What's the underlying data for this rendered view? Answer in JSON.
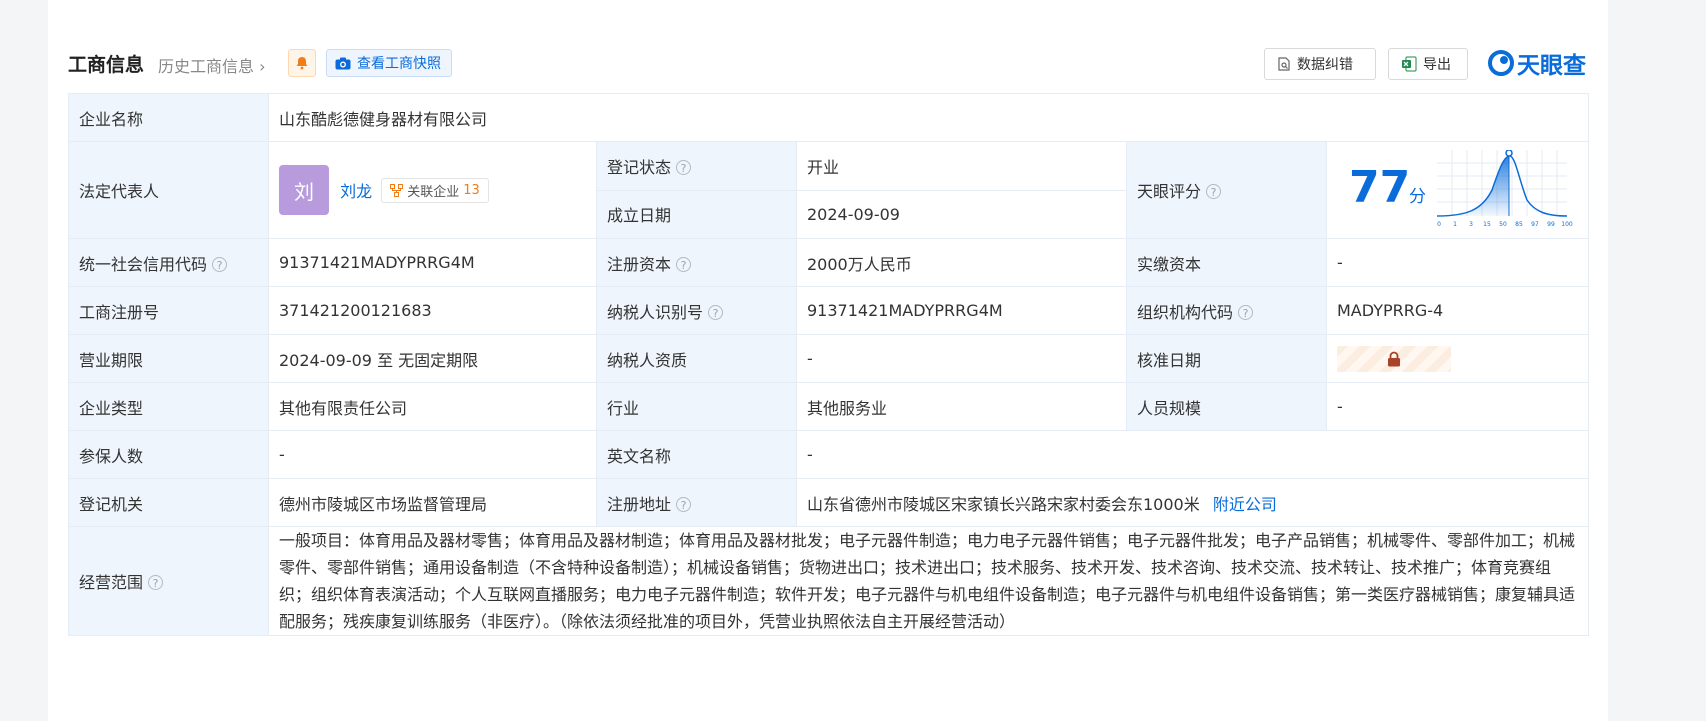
{
  "header": {
    "title": "工商信息",
    "history_link": "历史工商信息",
    "snapshot_button": "查看工商快照",
    "correct_button": "数据纠错",
    "export_button": "导出",
    "logo_text": "天眼查"
  },
  "colors": {
    "accent": "#0a6cda",
    "status_green": "#1ba55a",
    "label_bg": "#eef5fc",
    "avatar": "#b79bdc"
  },
  "company": {
    "name_label": "企业名称",
    "name_value": "山东酷彪德健身器材有限公司",
    "legal_rep_label": "法定代表人",
    "legal_rep_avatar_char": "刘",
    "legal_rep_name": "刘龙",
    "related_label": "关联企业",
    "related_count": "13",
    "reg_status_label": "登记状态",
    "reg_status_value": "开业",
    "founded_label": "成立日期",
    "founded_value": "2024-09-09",
    "rating_label": "天眼评分",
    "rating_score": "77",
    "rating_unit": "分",
    "rating_ticks": [
      "0",
      "1",
      "3",
      "15",
      "50",
      "85",
      "97",
      "99",
      "100"
    ],
    "credit_code_label": "统一社会信用代码",
    "credit_code_value": "91371421MADYPRRG4M",
    "reg_capital_label": "注册资本",
    "reg_capital_value": "2000万人民币",
    "paid_capital_label": "实缴资本",
    "paid_capital_value": "-",
    "biz_reg_no_label": "工商注册号",
    "biz_reg_no_value": "371421200121683",
    "taxpayer_id_label": "纳税人识别号",
    "taxpayer_id_value": "91371421MADYPRRG4M",
    "org_code_label": "组织机构代码",
    "org_code_value": "MADYPRRG-4",
    "term_label": "营业期限",
    "term_value": "2024-09-09 至 无固定期限",
    "taxpayer_qual_label": "纳税人资质",
    "taxpayer_qual_value": "-",
    "approval_date_label": "核准日期",
    "type_label": "企业类型",
    "type_value": "其他有限责任公司",
    "industry_label": "行业",
    "industry_value": "其他服务业",
    "staff_label": "人员规模",
    "staff_value": "-",
    "insured_label": "参保人数",
    "insured_value": "-",
    "english_name_label": "英文名称",
    "english_name_value": "-",
    "authority_label": "登记机关",
    "authority_value": "德州市陵城区市场监督管理局",
    "address_label": "注册地址",
    "address_value": "山东省德州市陵城区宋家镇长兴路宋家村委会东1000米",
    "nearby_link": "附近公司",
    "scope_label": "经营范围",
    "scope_value": "一般项目：体育用品及器材零售；体育用品及器材制造；体育用品及器材批发；电子元器件制造；电力电子元器件销售；电子元器件批发；电子产品销售；机械零件、零部件加工；机械零件、零部件销售；通用设备制造（不含特种设备制造）；机械设备销售；货物进出口；技术进出口；技术服务、技术开发、技术咨询、技术交流、技术转让、技术推广；体育竞赛组织；组织体育表演活动；个人互联网直播服务；电力电子元器件制造；软件开发；电子元器件与机电组件设备制造；电子元器件与机电组件设备销售；第一类医疗器械销售；康复辅具适配服务；残疾康复训练服务（非医疗）。（除依法须经批准的项目外，凭营业执照依法自主开展经营活动）"
  },
  "icons": {
    "bell": "bell-icon",
    "camera": "camera-icon",
    "doc": "document-search-icon",
    "excel": "excel-icon",
    "lock": "lock-icon",
    "help": "question-icon",
    "related": "network-icon"
  }
}
